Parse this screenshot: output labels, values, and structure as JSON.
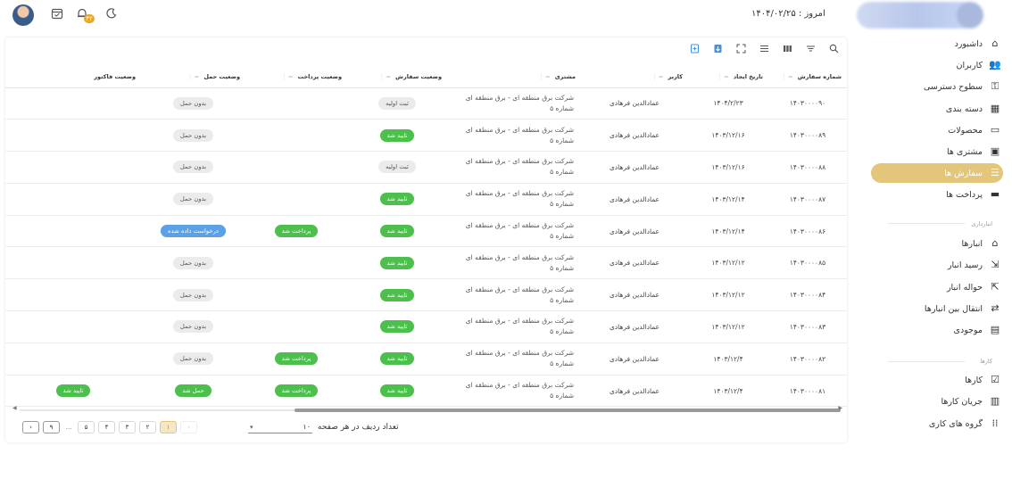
{
  "topbar": {
    "date_label": "امروز : ۱۴۰۴/۰۲/۲۵",
    "notification_count": "۴۲"
  },
  "sidebar": {
    "items": [
      {
        "label": "داشبورد",
        "icon": "home-icon"
      },
      {
        "label": "کاربران",
        "icon": "users-icon"
      },
      {
        "label": "سطوح دسترسی",
        "icon": "access-icon"
      },
      {
        "label": "دسته بندی",
        "icon": "category-icon"
      },
      {
        "label": "محصولات",
        "icon": "product-icon"
      },
      {
        "label": "مشتری ها",
        "icon": "customer-icon"
      },
      {
        "label": "سفارش ها",
        "icon": "order-icon",
        "active": true
      },
      {
        "label": "پرداخت ها",
        "icon": "payment-icon"
      }
    ],
    "section_warehouse": "انبارداری",
    "warehouse_items": [
      {
        "label": "انبارها",
        "icon": "warehouse-icon"
      },
      {
        "label": "رسید انبار",
        "icon": "receipt-icon"
      },
      {
        "label": "حواله انبار",
        "icon": "remittance-icon"
      },
      {
        "label": "انتقال بین انبارها",
        "icon": "transfer-icon"
      },
      {
        "label": "موجودی",
        "icon": "inventory-icon"
      }
    ],
    "section_tasks": "کارها",
    "task_items": [
      {
        "label": "کارها",
        "icon": "tasks-icon"
      },
      {
        "label": "جریان کارها",
        "icon": "workflow-icon"
      },
      {
        "label": "گروه های کاری",
        "icon": "groups-icon"
      }
    ]
  },
  "table": {
    "headers": [
      "شماره سفارش",
      "تاریخ ایجاد",
      "کاربر",
      "مشتری",
      "وضعیت سفارش",
      "وضعیت پرداخت",
      "وضعیت حمل",
      "وضعیت فاکتور"
    ],
    "rows": [
      {
        "order_no": "۱۴۰۳۰۰۰۰۹۰",
        "date": "۱۴۰۴/۲/۲۳",
        "user": "عمادالدین فرهادی",
        "customer": "شرکت برق منطقه ای - برق منطقه ای شماره ۵",
        "order_status": "ثبت اولیه",
        "order_color": "gray",
        "payment_status": "",
        "payment_color": "",
        "shipping_status": "بدون حمل",
        "shipping_color": "gray",
        "invoice_status": "",
        "invoice_color": ""
      },
      {
        "order_no": "۱۴۰۳۰۰۰۰۸۹",
        "date": "۱۴۰۳/۱۲/۱۶",
        "user": "عمادالدین فرهادی",
        "customer": "شرکت برق منطقه ای - برق منطقه ای شماره ۵",
        "order_status": "تایید شد",
        "order_color": "green",
        "payment_status": "",
        "payment_color": "",
        "shipping_status": "بدون حمل",
        "shipping_color": "gray",
        "invoice_status": "",
        "invoice_color": ""
      },
      {
        "order_no": "۱۴۰۳۰۰۰۰۸۸",
        "date": "۱۴۰۳/۱۲/۱۶",
        "user": "عمادالدین فرهادی",
        "customer": "شرکت برق منطقه ای - برق منطقه ای شماره ۵",
        "order_status": "ثبت اولیه",
        "order_color": "gray",
        "payment_status": "",
        "payment_color": "",
        "shipping_status": "بدون حمل",
        "shipping_color": "gray",
        "invoice_status": "",
        "invoice_color": ""
      },
      {
        "order_no": "۱۴۰۳۰۰۰۰۸۷",
        "date": "۱۴۰۳/۱۲/۱۴",
        "user": "عمادالدین فرهادی",
        "customer": "شرکت برق منطقه ای - برق منطقه ای شماره ۵",
        "order_status": "تایید شد",
        "order_color": "green",
        "payment_status": "",
        "payment_color": "",
        "shipping_status": "بدون حمل",
        "shipping_color": "gray",
        "invoice_status": "",
        "invoice_color": ""
      },
      {
        "order_no": "۱۴۰۳۰۰۰۰۸۶",
        "date": "۱۴۰۳/۱۲/۱۴",
        "user": "عمادالدین فرهادی",
        "customer": "شرکت برق منطقه ای - برق منطقه ای شماره ۵",
        "order_status": "تایید شد",
        "order_color": "green",
        "payment_status": "پرداخت شد",
        "payment_color": "green",
        "shipping_status": "درخواست داده شده",
        "shipping_color": "blue",
        "invoice_status": "",
        "invoice_color": ""
      },
      {
        "order_no": "۱۴۰۳۰۰۰۰۸۵",
        "date": "۱۴۰۳/۱۲/۱۲",
        "user": "عمادالدین فرهادی",
        "customer": "شرکت برق منطقه ای - برق منطقه ای شماره ۵",
        "order_status": "تایید شد",
        "order_color": "green",
        "payment_status": "",
        "payment_color": "",
        "shipping_status": "بدون حمل",
        "shipping_color": "gray",
        "invoice_status": "",
        "invoice_color": ""
      },
      {
        "order_no": "۱۴۰۳۰۰۰۰۸۴",
        "date": "۱۴۰۳/۱۲/۱۲",
        "user": "عمادالدین فرهادی",
        "customer": "شرکت برق منطقه ای - برق منطقه ای شماره ۵",
        "order_status": "تایید شد",
        "order_color": "green",
        "payment_status": "",
        "payment_color": "",
        "shipping_status": "بدون حمل",
        "shipping_color": "gray",
        "invoice_status": "",
        "invoice_color": ""
      },
      {
        "order_no": "۱۴۰۳۰۰۰۰۸۳",
        "date": "۱۴۰۳/۱۲/۱۲",
        "user": "عمادالدین فرهادی",
        "customer": "شرکت برق منطقه ای - برق منطقه ای شماره ۵",
        "order_status": "تایید شد",
        "order_color": "green",
        "payment_status": "",
        "payment_color": "",
        "shipping_status": "بدون حمل",
        "shipping_color": "gray",
        "invoice_status": "",
        "invoice_color": ""
      },
      {
        "order_no": "۱۴۰۳۰۰۰۰۸۲",
        "date": "۱۴۰۳/۱۲/۴",
        "user": "عمادالدین فرهادی",
        "customer": "شرکت برق منطقه ای - برق منطقه ای شماره ۵",
        "order_status": "تایید شد",
        "order_color": "green",
        "payment_status": "پرداخت شد",
        "payment_color": "green",
        "shipping_status": "بدون حمل",
        "shipping_color": "gray",
        "invoice_status": "",
        "invoice_color": ""
      },
      {
        "order_no": "۱۴۰۳۰۰۰۰۸۱",
        "date": "۱۴۰۳/۱۲/۴",
        "user": "عمادالدین فرهادی",
        "customer": "شرکت برق منطقه ای - برق منطقه ای شماره ۵",
        "order_status": "تایید شد",
        "order_color": "green",
        "payment_status": "پرداخت شد",
        "payment_color": "green",
        "shipping_status": "حمل شد",
        "shipping_color": "green",
        "invoice_status": "تایید شد",
        "invoice_color": "green"
      }
    ]
  },
  "footer": {
    "rows_per_page_label": "تعداد ردیف در هر صفحه",
    "rows_per_page_value": "۱۰",
    "pages": [
      "۱",
      "۲",
      "۳",
      "۴",
      "۵"
    ],
    "ellipsis": "...",
    "last_page": "۹",
    "prev": "‹",
    "next": "›"
  },
  "colors": {
    "accent": "#e4c67a",
    "green_chip": "#4cbf4c",
    "blue_chip": "#5aa1e8",
    "gray_chip": "#ebebeb"
  }
}
